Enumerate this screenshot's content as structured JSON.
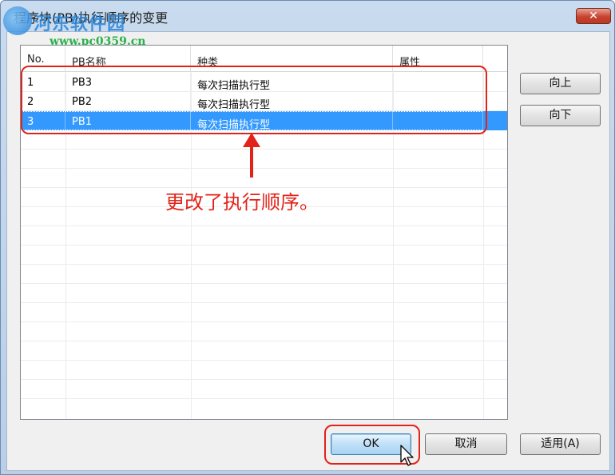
{
  "window": {
    "title": "程序块(PB)执行顺序的变更",
    "close_glyph": "✕"
  },
  "watermark": {
    "name": "河东软件园",
    "url": "www.pc0359.cn"
  },
  "list": {
    "columns": [
      "No.",
      "PB名称",
      "种类",
      "属性"
    ],
    "rows": [
      {
        "no": "1",
        "name": "PB3",
        "type": "每次扫描执行型",
        "attr": ""
      },
      {
        "no": "2",
        "name": "PB2",
        "type": "每次扫描执行型",
        "attr": ""
      },
      {
        "no": "3",
        "name": "PB1",
        "type": "每次扫描执行型",
        "attr": "",
        "selected": true
      }
    ]
  },
  "side_buttons": {
    "up": "向上",
    "down": "向下"
  },
  "footer_buttons": {
    "ok": "OK",
    "cancel": "取消",
    "apply": "适用(A)"
  },
  "annotation": {
    "text": "更改了执行顺序。",
    "color": "#e2231a"
  },
  "colors": {
    "selection": "#3399ff",
    "annotation": "#e2231a"
  }
}
